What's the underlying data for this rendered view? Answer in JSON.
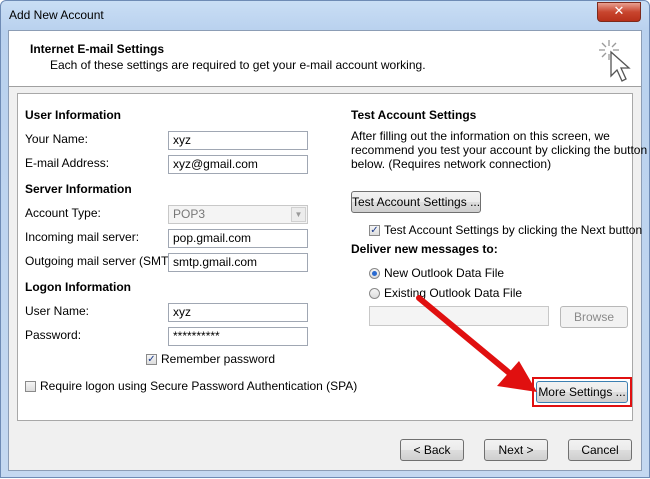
{
  "window": {
    "title": "Add New Account",
    "close_glyph": "✕"
  },
  "header": {
    "title": "Internet E-mail Settings",
    "subtitle": "Each of these settings are required to get your e-mail account working."
  },
  "user_info": {
    "heading": "User Information",
    "name_label": "Your Name:",
    "name_value": "xyz",
    "email_label": "E-mail Address:",
    "email_value": "xyz@gmail.com"
  },
  "server_info": {
    "heading": "Server Information",
    "account_type_label": "Account Type:",
    "account_type_value": "POP3",
    "incoming_label": "Incoming mail server:",
    "incoming_value": "pop.gmail.com",
    "outgoing_label": "Outgoing mail server (SMTP):",
    "outgoing_value": "smtp.gmail.com"
  },
  "logon_info": {
    "heading": "Logon Information",
    "user_label": "User Name:",
    "user_value": "xyz",
    "password_label": "Password:",
    "password_value": "**********",
    "remember_label": "Remember password",
    "remember_checked": true,
    "spa_label": "Require logon using Secure Password Authentication (SPA)",
    "spa_checked": false
  },
  "test": {
    "heading": "Test Account Settings",
    "description_1": "After filling out the information on this screen, we",
    "description_2": "recommend you test your account by clicking the button",
    "description_3": "below. (Requires network connection)",
    "button_label": "Test Account Settings ...",
    "checkbox_label": "Test Account Settings by clicking the Next button",
    "checkbox_checked": true
  },
  "deliver": {
    "heading": "Deliver new messages to:",
    "new_label": "New Outlook Data File",
    "existing_label": "Existing Outlook Data File",
    "selected": "new",
    "browse_label": "Browse"
  },
  "more_settings_label": "More Settings ...",
  "footer": {
    "back_label": "< Back",
    "next_label": "Next >",
    "cancel_label": "Cancel"
  },
  "colors": {
    "highlight": "#e01010",
    "arrow": "#e01010"
  },
  "icons": {
    "header": "wizard-cursor-sparkle-icon",
    "check": "checkmark-icon",
    "dropdown": "chevron-down-icon"
  }
}
